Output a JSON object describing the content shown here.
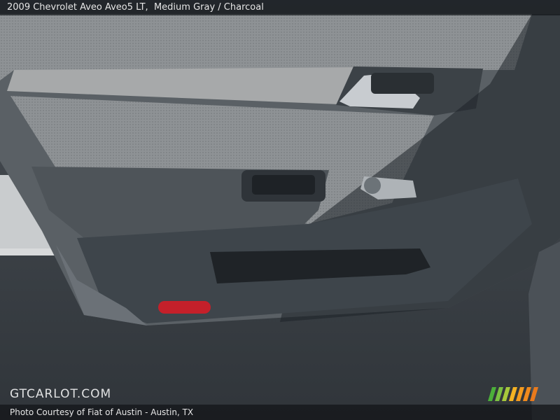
{
  "caption": {
    "vehicle": "2009 Chevrolet Aveo Aveo5 LT,",
    "colors": "Medium Gray / Charcoal"
  },
  "watermark": {
    "site": "GTCARLOT.COM"
  },
  "credit": {
    "text": "Photo Courtesy of Fiat of Austin - Austin, TX"
  },
  "colors": {
    "door_fabric": "#8d9194",
    "door_plastic": "#4c5257",
    "pavement": "#3a4046",
    "reflector": "#c4202a"
  }
}
